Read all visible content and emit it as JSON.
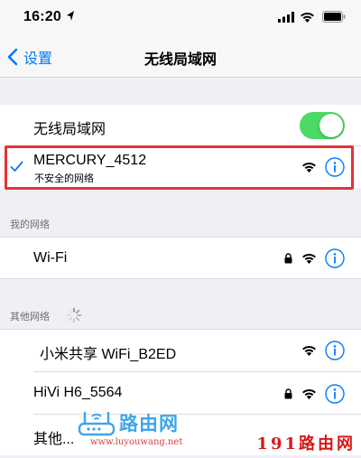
{
  "status_bar": {
    "time": "16:20"
  },
  "nav": {
    "back_label": "设置",
    "title": "无线局域网"
  },
  "wlan_toggle": {
    "label": "无线局域网",
    "enabled": true
  },
  "connected": {
    "ssid": "MERCURY_4512",
    "subtitle": "不安全的网络",
    "secured": false
  },
  "my_networks": {
    "header": "我的网络",
    "items": [
      {
        "ssid": "Wi-Fi",
        "locked": true
      }
    ]
  },
  "other_networks": {
    "header": "其他网络",
    "items": [
      {
        "ssid": "小米共享 WiFi_B2ED",
        "locked": false
      },
      {
        "ssid": "HiVi H6_5564",
        "locked": true
      },
      {
        "ssid": "其他...",
        "locked": false
      }
    ]
  },
  "watermark": {
    "brand": "路由网",
    "url": "www.luyouwang.net",
    "corner": "191路由网"
  },
  "colors": {
    "accent": "#007aff",
    "toggle_on": "#4cd964",
    "highlight": "#e8303a"
  }
}
